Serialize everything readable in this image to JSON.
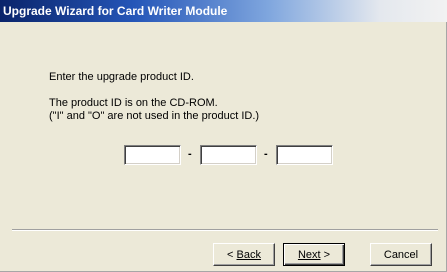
{
  "window": {
    "title": "Upgrade Wizard for Card Writer Module"
  },
  "instructions": {
    "prompt": "Enter the upgrade product ID.",
    "hint_line_1": "The product ID is on the CD-ROM.",
    "hint_line_2": "(\"I\" and \"O\" are not used in the product ID.)"
  },
  "product_id": {
    "fields": [
      {
        "value": "",
        "placeholder": ""
      },
      {
        "value": "",
        "placeholder": ""
      },
      {
        "value": "",
        "placeholder": ""
      }
    ],
    "separator": "-"
  },
  "buttons": {
    "back_prefix": "< ",
    "back_label": "Back",
    "next_label": "Next",
    "next_suffix": " >",
    "cancel_label": "Cancel"
  }
}
